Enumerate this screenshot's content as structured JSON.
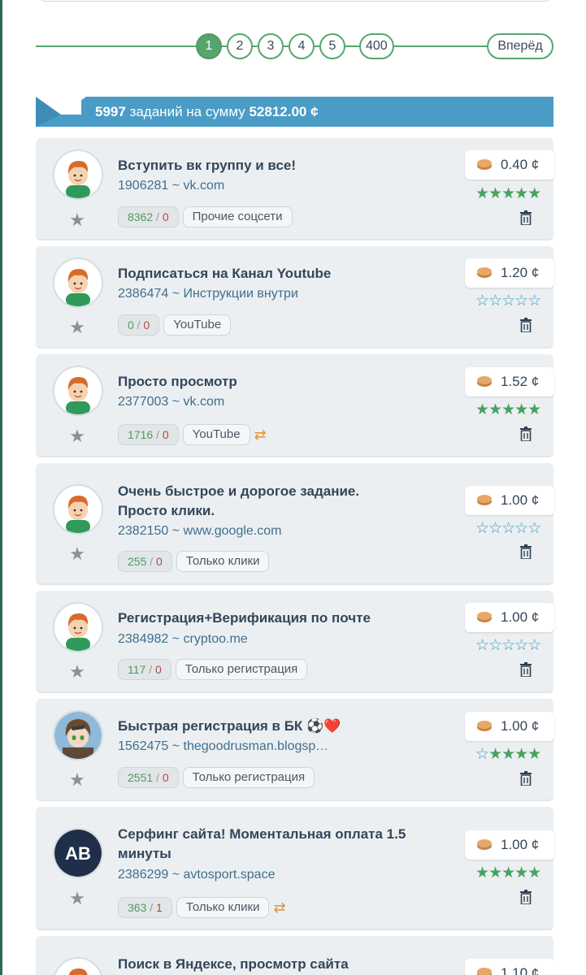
{
  "pagination": {
    "pages": [
      "1",
      "2",
      "3",
      "4",
      "5",
      "400"
    ],
    "active": "1",
    "next_label": "Вперёд"
  },
  "summary": {
    "count": "5997",
    "text_middle": "заданий на сумму",
    "sum": "52812.00 ¢"
  },
  "colors": {
    "accent_green": "#57a56e",
    "banner_blue": "#4a9cc6",
    "star_blue": "#3e9ac6",
    "repeat_orange": "#e8902e"
  },
  "tasks": [
    {
      "title": "Вступить вк группу и все!",
      "id_line": "1906281 ~ vk.com",
      "done": "8362",
      "failed": "0",
      "category": "Прочие соцсети",
      "price": "0.40 ¢",
      "stars": "★★★★★",
      "repeat": false,
      "avatar": "boy-avatar"
    },
    {
      "title": "Подписаться на Канал Youtube",
      "id_line": "2386474 ~ Инструкции внутри",
      "done": "0",
      "failed": "0",
      "category": "YouTube",
      "price": "1.20 ¢",
      "stars": "☆☆☆☆☆",
      "repeat": false,
      "avatar": "boy-avatar"
    },
    {
      "title": "Просто просмотр",
      "id_line": "2377003 ~ vk.com",
      "done": "1716",
      "failed": "0",
      "category": "YouTube",
      "price": "1.52 ¢",
      "stars": "★★★★★",
      "repeat": true,
      "avatar": "boy-avatar"
    },
    {
      "title": "Очень быстрое и дорогое задание. Просто клики.",
      "id_line": "2382150 ~ www.google.com",
      "done": "255",
      "failed": "0",
      "category": "Только клики",
      "price": "1.00 ¢",
      "stars": "☆☆☆☆☆",
      "repeat": false,
      "avatar": "boy-avatar"
    },
    {
      "title": "Регистрация+Верификация по почте",
      "id_line": "2384982 ~ cryptoo.me",
      "done": "117",
      "failed": "0",
      "category": "Только регистрация",
      "price": "1.00 ¢",
      "stars": "☆☆☆☆☆",
      "repeat": false,
      "avatar": "boy-avatar"
    },
    {
      "title": "Быстрая регистрация в БК ⚽❤️",
      "id_line": "1562475 ~ thegoodrusman.blogsp…",
      "done": "2551",
      "failed": "0",
      "category": "Только регистрация",
      "price": "1.00 ¢",
      "stars": "☆★★★★",
      "repeat": false,
      "avatar": "anime-avatar"
    },
    {
      "title": "Серфинг сайта! Моментальная оплата 1.5 минуты",
      "id_line": "2386299 ~ avtosport.space",
      "done": "363",
      "failed": "1",
      "category": "Только клики",
      "price": "1.00 ¢",
      "stars": "★★★★★",
      "repeat": true,
      "avatar": "ab-avatar",
      "avatar_text": "AB"
    },
    {
      "title": "Поиск в Яндексе, просмотр сайта",
      "price": "1.10 ¢",
      "avatar": "boy-avatar"
    }
  ]
}
